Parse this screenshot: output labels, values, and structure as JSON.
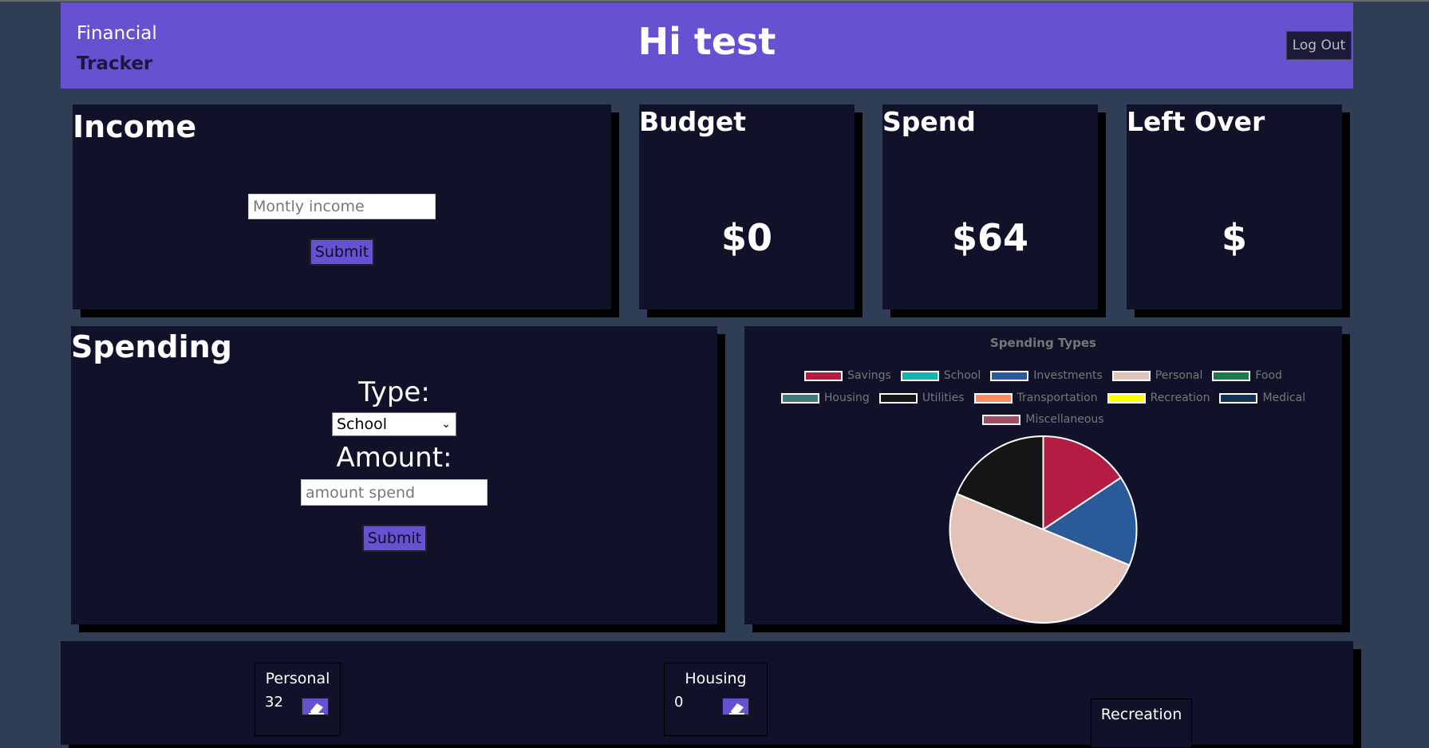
{
  "header": {
    "brand_line1": "Financial",
    "brand_line2": "Tracker",
    "greeting": "Hi test",
    "logout_label": "Log Out"
  },
  "income": {
    "title": "Income",
    "placeholder": "Montly income",
    "submit_label": "Submit"
  },
  "budget": {
    "title": "Budget",
    "value": "$0"
  },
  "spend": {
    "title": "Spend",
    "value": "$64"
  },
  "leftover": {
    "title": "Left Over",
    "value": "$"
  },
  "spending": {
    "title": "Spending",
    "type_label": "Type:",
    "type_selected": "School",
    "amount_label": "Amount:",
    "amount_placeholder": "amount spend",
    "submit_label": "Submit"
  },
  "chart_data": {
    "type": "pie",
    "title": "Spending Types",
    "legend_position": "top",
    "categories": [
      "Savings",
      "School",
      "Investments",
      "Personal",
      "Food",
      "Housing",
      "Utilities",
      "Transportation",
      "Recreation",
      "Medical",
      "Miscellaneous"
    ],
    "colors": [
      "#b51c44",
      "#11b3b3",
      "#2b5a9a",
      "#e5c2b8",
      "#1e7a4a",
      "#3f7a7a",
      "#151515",
      "#ff8a5c",
      "#ffff00",
      "#0d3355",
      "#9c4e66"
    ],
    "values": [
      10,
      0,
      10,
      32,
      0,
      0,
      12,
      0,
      0,
      0,
      0
    ]
  },
  "spend_items": [
    {
      "title": "Personal",
      "value": "32"
    },
    {
      "title": "Housing",
      "value": "0"
    },
    {
      "title": "Recreation",
      "value": ""
    }
  ]
}
